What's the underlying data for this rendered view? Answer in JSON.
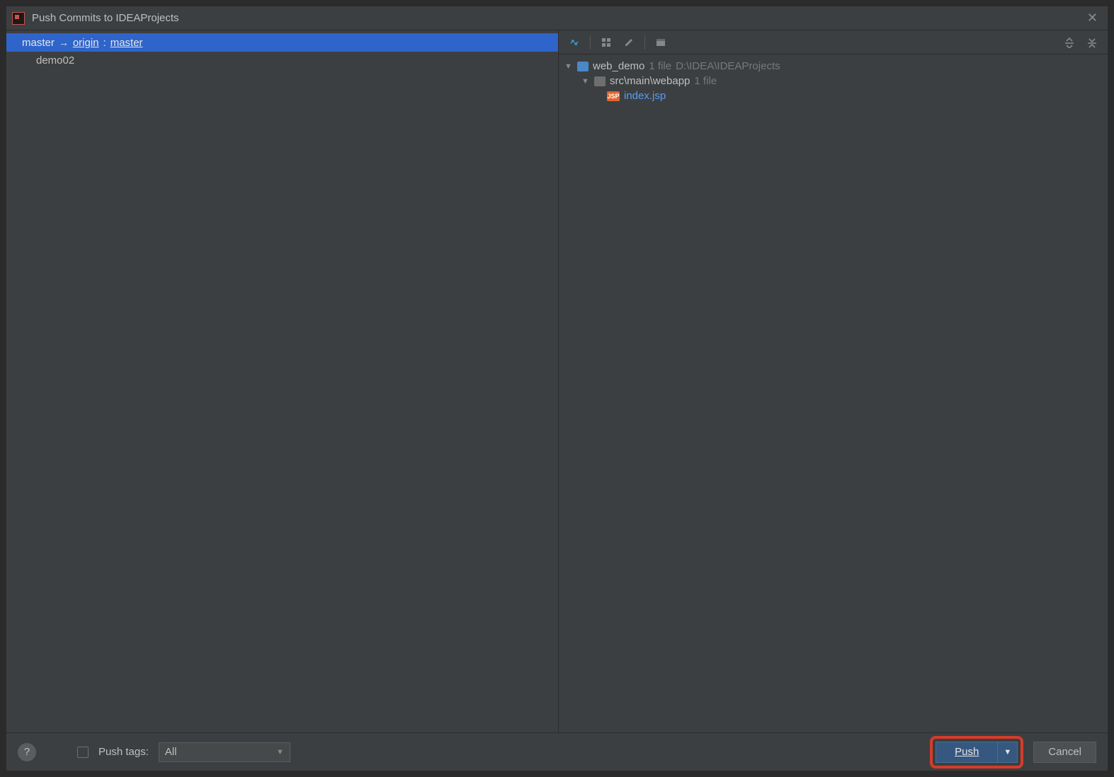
{
  "title": "Push Commits to IDEAProjects",
  "branch": {
    "local": "master",
    "remote": "origin",
    "remote_branch": "master",
    "sep": ":"
  },
  "commits": [
    "demo02"
  ],
  "tree": {
    "root": {
      "name": "web_demo",
      "meta": "1 file",
      "path": "D:\\IDEA\\IDEAProjects"
    },
    "folder": {
      "name": "src\\main\\webapp",
      "meta": "1 file"
    },
    "file": {
      "name": "index.jsp",
      "icon_label": "JSP"
    }
  },
  "footer": {
    "push_tags_label": "Push tags:",
    "select_value": "All",
    "push_label": "Push",
    "cancel_label": "Cancel",
    "help_label": "?"
  }
}
